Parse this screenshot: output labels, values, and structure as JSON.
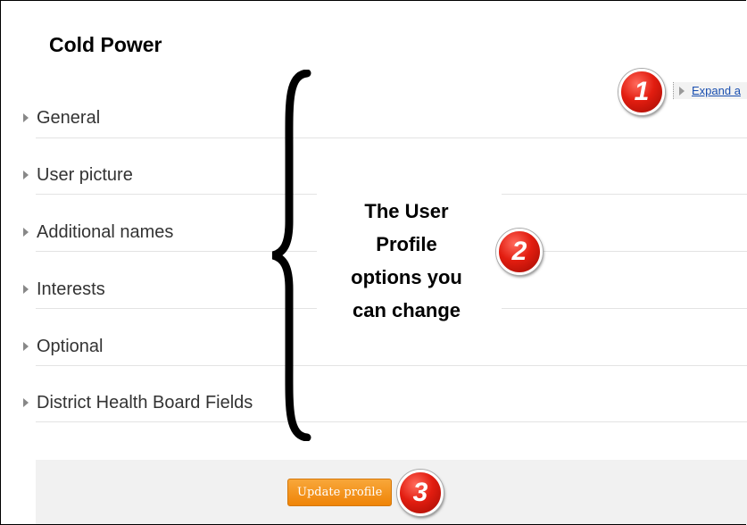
{
  "page": {
    "title": "Cold Power"
  },
  "expand_link": "Expand a",
  "sections": [
    {
      "label": "General"
    },
    {
      "label": "User picture"
    },
    {
      "label": "Additional names"
    },
    {
      "label": "Interests"
    },
    {
      "label": "Optional"
    },
    {
      "label": "District Health Board Fields"
    }
  ],
  "annotation": {
    "text_1": "The User",
    "text_2": "Profile",
    "text_3": "options you",
    "text_4": "can change"
  },
  "badges": [
    "1",
    "2",
    "3"
  ],
  "footer": {
    "button_label": "Update profile"
  },
  "colors": {
    "accent": "#ef8407",
    "badge": "#e21d10",
    "link": "#1a4fb0"
  }
}
